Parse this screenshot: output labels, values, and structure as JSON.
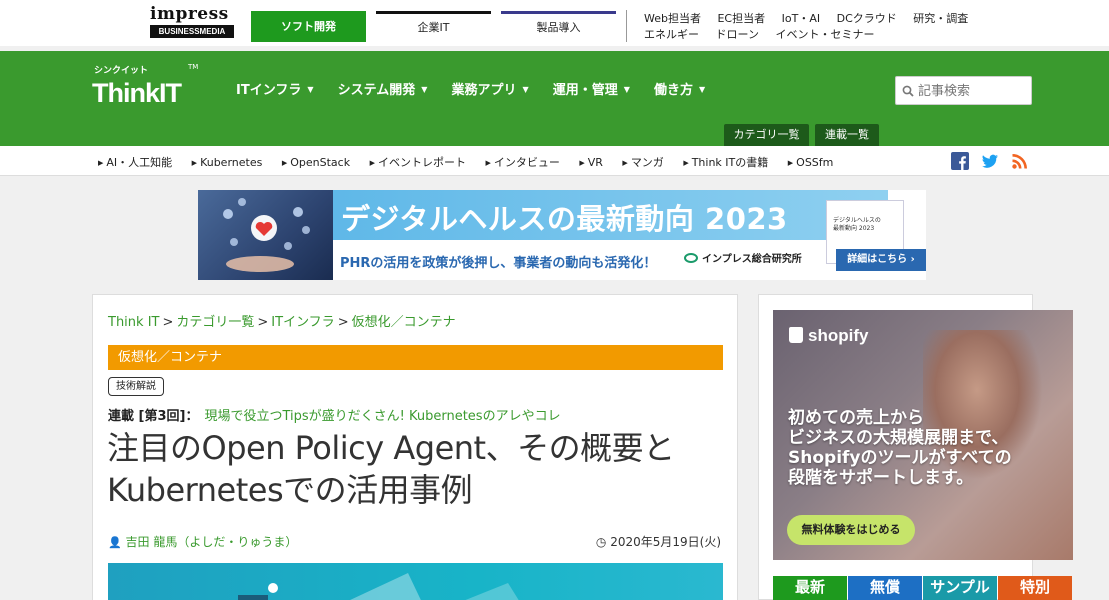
{
  "media_bar": {
    "logo_word": "impress",
    "logo_sub": "BUSINESSMEDIA",
    "tabs": [
      "ソフト開発",
      "企業IT",
      "製品導入"
    ],
    "links_row1": [
      "Web担当者",
      "EC担当者",
      "IoT・AI",
      "DCクラウド",
      "研究・調査"
    ],
    "links_row2": [
      "エネルギー",
      "ドローン",
      "イベント・セミナー"
    ]
  },
  "header": {
    "logo_kana": "シンクイット",
    "logo_name": "ThinkIT",
    "logo_tm": "TM",
    "nav": [
      "ITインフラ",
      "システム開発",
      "業務アプリ",
      "運用・管理",
      "働き方"
    ],
    "search_placeholder": "記事検索",
    "category_button": "カテゴリ一覧",
    "series_button": "連載一覧"
  },
  "subnav": {
    "links": [
      "AI・人工知能",
      "Kubernetes",
      "OpenStack",
      "イベントレポート",
      "インタビュー",
      "VR",
      "マンガ",
      "Think ITの書籍",
      "OSSfm"
    ]
  },
  "banner": {
    "title": "デジタルヘルスの最新動向 2023",
    "subtitle": "PHRの活用を政策が後押し、事業者の動向も活発化！",
    "publisher": "インプレス総合研究所",
    "publisher_logo": "Impress",
    "book_line1": "デジタルヘルスの",
    "book_line2": "最新動向 2023",
    "cta": "詳細はこちら"
  },
  "article": {
    "breadcrumb": [
      "Think IT",
      "カテゴリ一覧",
      "ITインフラ",
      "仮想化／コンテナ"
    ],
    "breadcrumb_sep": ">",
    "category": "仮想化／コンテナ",
    "tag": "技術解説",
    "series_label": "連載 [第3回]：",
    "series_title": "現場で役立つTipsが盛りだくさん! Kubernetesのアレやコレ",
    "title": "注目のOpen Policy Agent、その概要とKubernetesでの活用事例",
    "author": "吉田 龍馬（よしだ・りゅうま）",
    "date": "2020年5月19日(火)"
  },
  "sidebar": {
    "ad_brand": "shopify",
    "ad_copy_1": "初めての売上から",
    "ad_copy_2": "ビジネスの大規模展開まで、",
    "ad_copy_3": "Shopifyのツールがすべての",
    "ad_copy_4": "段階をサポートします。",
    "ad_cta": "無料体験をはじめる",
    "tabs": [
      "最新",
      "無償",
      "サンプル",
      "特別"
    ]
  },
  "colors": {
    "brand_green": "#3a9a2e",
    "category_orange": "#f29a00",
    "dark_green": "#1d5a1a"
  }
}
